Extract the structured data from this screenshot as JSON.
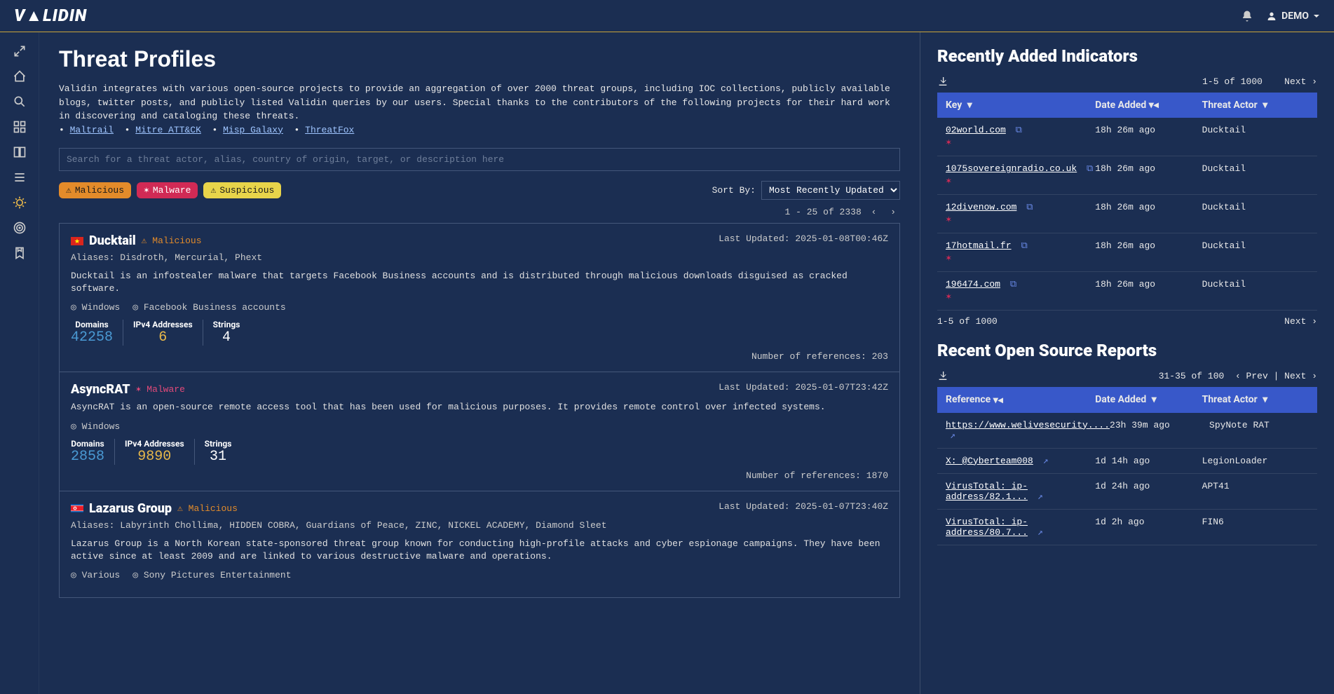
{
  "header": {
    "logo": "V▲LIDIN",
    "user": "DEMO"
  },
  "page": {
    "title": "Threat Profiles",
    "intro_a": "Validin integrates with various open-source projects to provide an aggregation of over 2000 threat groups, including IOC collections, publicly available blogs, twitter posts, and publicly listed Validin queries by our users. Special thanks to the contributors of the following projects for their hard work in discovering and cataloging these threats.",
    "links": [
      "Maltrail",
      "Mitre ATT&CK",
      "Misp Galaxy",
      "ThreatFox"
    ],
    "search_placeholder": "Search for a threat actor, alias, country of origin, target, or description here",
    "chips": {
      "malicious": "Malicious",
      "malware": "Malware",
      "suspicious": "Suspicious"
    },
    "sort_label": "Sort By:",
    "sort_value": "Most Recently Updated",
    "pager": "1 - 25 of 2338"
  },
  "threats": [
    {
      "name": "Ducktail",
      "flag": "vn",
      "tag": "Malicious",
      "tag_class": "malicious",
      "updated": "Last Updated: 2025-01-08T00:46Z",
      "aliases": "Aliases: Disdroth, Mercurial, Phext",
      "desc": "Ducktail is an infostealer malware that targets Facebook Business accounts and is distributed through malicious downloads disguised as cracked software.",
      "targets": [
        "Windows",
        "Facebook Business accounts"
      ],
      "stats": [
        {
          "label": "Domains",
          "value": "42258",
          "cls": "stat-blue"
        },
        {
          "label": "IPv4 Addresses",
          "value": "6",
          "cls": "stat-yellow"
        },
        {
          "label": "Strings",
          "value": "4",
          "cls": "stat-white"
        }
      ],
      "refs": "Number of references: 203"
    },
    {
      "name": "AsyncRAT",
      "flag": "",
      "tag": "Malware",
      "tag_class": "malware",
      "updated": "Last Updated: 2025-01-07T23:42Z",
      "aliases": "",
      "desc": "AsyncRAT is an open-source remote access tool that has been used for malicious purposes. It provides remote control over infected systems.",
      "targets": [
        "Windows"
      ],
      "stats": [
        {
          "label": "Domains",
          "value": "2858",
          "cls": "stat-blue"
        },
        {
          "label": "IPv4 Addresses",
          "value": "9890",
          "cls": "stat-yellow"
        },
        {
          "label": "Strings",
          "value": "31",
          "cls": "stat-white"
        }
      ],
      "refs": "Number of references: 1870"
    },
    {
      "name": "Lazarus Group",
      "flag": "kp",
      "tag": "Malicious",
      "tag_class": "malicious",
      "updated": "Last Updated: 2025-01-07T23:40Z",
      "aliases": "Aliases: Labyrinth Chollima, HIDDEN COBRA, Guardians of Peace, ZINC, NICKEL ACADEMY, Diamond Sleet",
      "desc": "Lazarus Group is a North Korean state-sponsored threat group known for conducting high-profile attacks and cyber espionage campaigns. They have been active since at least 2009 and are linked to various destructive malware and operations.",
      "targets": [
        "Various",
        "Sony Pictures Entertainment"
      ],
      "stats": [],
      "refs": ""
    }
  ],
  "indicators": {
    "title": "Recently Added Indicators",
    "range": "1-5 of 1000",
    "next": "Next",
    "range_bottom": "1-5 of 1000",
    "headers": {
      "key": "Key",
      "date": "Date Added",
      "actor": "Threat Actor"
    },
    "rows": [
      {
        "key": "02world.com",
        "date": "18h 26m ago",
        "actor": "Ducktail"
      },
      {
        "key": "1075sovereignradio.co.uk",
        "date": "18h 26m ago",
        "actor": "Ducktail"
      },
      {
        "key": "12divenow.com",
        "date": "18h 26m ago",
        "actor": "Ducktail"
      },
      {
        "key": "17hotmail.fr",
        "date": "18h 26m ago",
        "actor": "Ducktail"
      },
      {
        "key": "196474.com",
        "date": "18h 26m ago",
        "actor": "Ducktail"
      }
    ]
  },
  "reports": {
    "title": "Recent Open Source Reports",
    "range": "31-35 of 100",
    "prev": "Prev",
    "next": "Next",
    "headers": {
      "ref": "Reference",
      "date": "Date Added",
      "actor": "Threat Actor"
    },
    "rows": [
      {
        "ref": "https://www.welivesecurity....",
        "date": "23h 39m ago",
        "actor": "SpyNote RAT"
      },
      {
        "ref": "X: @Cyberteam008",
        "date": "1d 14h ago",
        "actor": "LegionLoader"
      },
      {
        "ref": "VirusTotal: ip-address/82.1...",
        "date": "1d 24h ago",
        "actor": "APT41"
      },
      {
        "ref": "VirusTotal: ip-address/80.7...",
        "date": "1d 2h ago",
        "actor": "FIN6"
      }
    ]
  }
}
